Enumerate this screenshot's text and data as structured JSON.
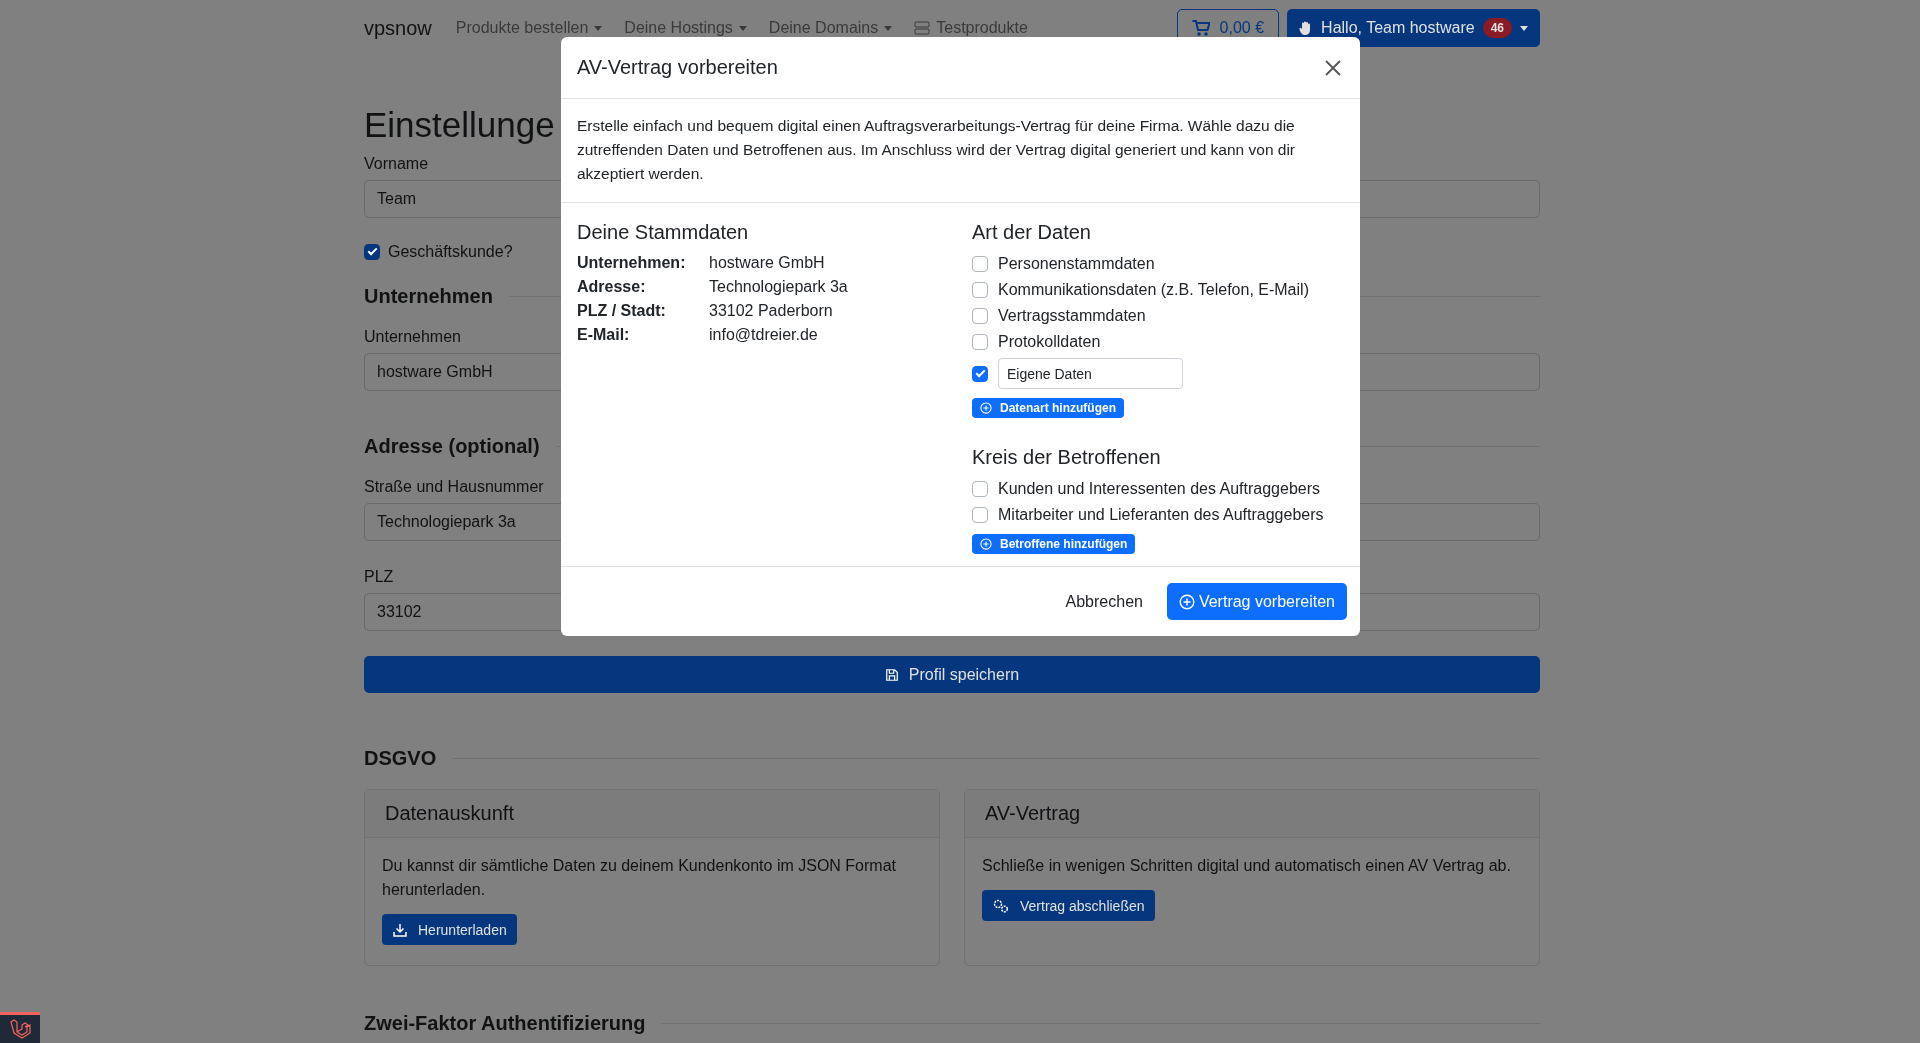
{
  "navbar": {
    "brand": "vpsnow",
    "items": [
      {
        "label": "Produkte bestellen",
        "kind": "dropdown"
      },
      {
        "label": "Deine Hostings",
        "kind": "dropdown"
      },
      {
        "label": "Deine Domains",
        "kind": "dropdown"
      },
      {
        "label": "Testprodukte",
        "kind": "link"
      }
    ],
    "cart": "0,00 €",
    "user": {
      "label": "Hallo, Team hostware",
      "badge": "46"
    }
  },
  "page": {
    "title": "Einstellunge",
    "blocks": [
      {
        "kind": "field",
        "label": "Vorname",
        "value": "Team"
      },
      {
        "kind": "checkbox",
        "label": "Geschäftskunde?",
        "checked": true
      },
      {
        "kind": "section",
        "title": "Unternehmen"
      },
      {
        "kind": "field",
        "label": "Unternehmen",
        "value": "hostware GmbH"
      },
      {
        "kind": "section",
        "title": "Adresse (optional)"
      },
      {
        "kind": "field",
        "label": "Straße und Hausnummer",
        "value": "Technologiepark 3a"
      },
      {
        "kind": "field",
        "label": "PLZ",
        "value": "33102"
      },
      {
        "kind": "save",
        "label": "Profil speichern"
      },
      {
        "kind": "section",
        "title": "DSGVO"
      },
      {
        "kind": "cards",
        "cards": [
          {
            "title": "Datenauskunft",
            "text": "Du kannst dir sämtliche Daten zu deinem Kundenkonto im JSON Format herunterladen.",
            "button": "Herunterladen"
          },
          {
            "title": "AV-Vertrag",
            "text": "Schließe in wenigen Schritten digital und automatisch einen AV Vertrag ab.",
            "button": "Vertrag abschließen"
          }
        ]
      },
      {
        "kind": "section",
        "title": "Zwei-Faktor Authentifizierung"
      }
    ]
  },
  "modal": {
    "title": "AV-Vertrag vorbereiten",
    "intro": "Erstelle einfach und bequem digital einen Auftragsverarbeitungs-Vertrag für deine Firma. Wähle dazu die zutreffenden Daten und Betroffenen aus. Im Anschluss wird der Vertrag digital generiert und kann von dir akzeptiert werden.",
    "master_data": {
      "title": "Deine Stammdaten",
      "rows": [
        {
          "label": "Unternehmen:",
          "value": "hostware GmbH"
        },
        {
          "label": "Adresse:",
          "value": "Technologiepark 3a"
        },
        {
          "label": "PLZ / Stadt:",
          "value": "33102 Paderborn"
        },
        {
          "label": "E-Mail:",
          "value": "info@tdreier.de"
        }
      ]
    },
    "groups": [
      {
        "title": "Art der Daten",
        "options": [
          {
            "kind": "option",
            "label": "Personenstammdaten",
            "checked": false
          },
          {
            "kind": "option",
            "label": "Kommunikationsdaten (z.B. Telefon, E-Mail)",
            "checked": false
          },
          {
            "kind": "option",
            "label": "Vertragsstammdaten",
            "checked": false
          },
          {
            "kind": "option",
            "label": "Protokolldaten",
            "checked": false
          },
          {
            "kind": "custom",
            "value": "Eigene Daten",
            "checked": true
          }
        ],
        "add_button": "Datenart hinzufügen"
      },
      {
        "title": "Kreis der Betroffenen",
        "options": [
          {
            "kind": "option",
            "label": "Kunden und Interessenten des Auftraggebers",
            "checked": false
          },
          {
            "kind": "option",
            "label": "Mitarbeiter und Lieferanten des Auftraggebers",
            "checked": false
          }
        ],
        "add_button": "Betroffene hinzufügen"
      }
    ],
    "cancel": "Abbrechen",
    "submit": "Vertrag vorbereiten"
  }
}
